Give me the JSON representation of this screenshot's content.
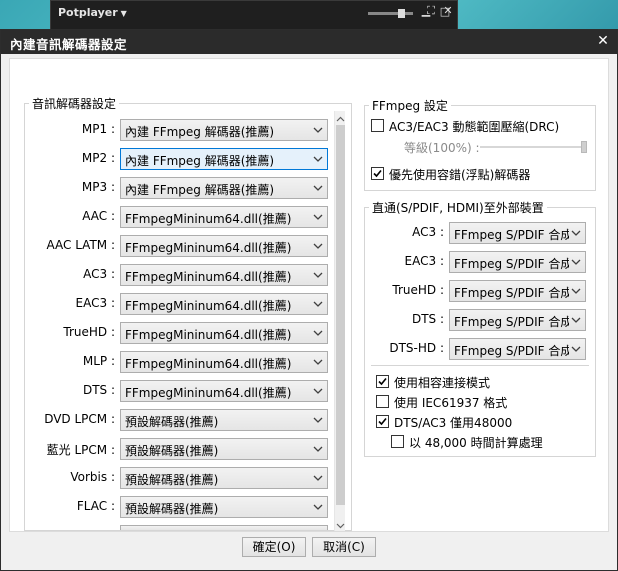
{
  "background_app": {
    "title": "Potplayer",
    "window_controls": [
      "▁",
      "□",
      "⛶",
      "✕"
    ]
  },
  "dialog": {
    "title": "內建音訊解碼器設定",
    "close_icon": "✕"
  },
  "decoder_group": {
    "legend": "音訊解碼器設定",
    "rows": [
      {
        "label": "MP1 :",
        "value": "內建 FFmpeg 解碼器(推薦)"
      },
      {
        "label": "MP2 :",
        "value": "內建 FFmpeg 解碼器(推薦)"
      },
      {
        "label": "MP3 :",
        "value": "內建 FFmpeg 解碼器(推薦)"
      },
      {
        "label": "AAC :",
        "value": "FFmpegMininum64.dll(推薦)"
      },
      {
        "label": "AAC LATM :",
        "value": "FFmpegMininum64.dll(推薦)"
      },
      {
        "label": "AC3 :",
        "value": "FFmpegMininum64.dll(推薦)"
      },
      {
        "label": "EAC3 :",
        "value": "FFmpegMininum64.dll(推薦)"
      },
      {
        "label": "TrueHD :",
        "value": "FFmpegMininum64.dll(推薦)"
      },
      {
        "label": "MLP :",
        "value": "FFmpegMininum64.dll(推薦)"
      },
      {
        "label": "DTS :",
        "value": "FFmpegMininum64.dll(推薦)"
      },
      {
        "label": "DVD LPCM :",
        "value": "預設解碼器(推薦)"
      },
      {
        "label": "藍光 LPCM :",
        "value": "預設解碼器(推薦)"
      },
      {
        "label": "Vorbis :",
        "value": "預設解碼器(推薦)"
      },
      {
        "label": "FLAC :",
        "value": "預設解碼器(推薦)"
      }
    ],
    "focused_index": 1
  },
  "ffmpeg_group": {
    "legend": "FFmpeg 設定",
    "drc_label": "AC3/EAC3 動態範圍壓縮(DRC)",
    "drc_checked": false,
    "level_label": "等級(100%) :",
    "level_value": 1.0,
    "float_decoder_label": "優先使用容錯(浮點)解碼器",
    "float_decoder_checked": true
  },
  "passthrough_group": {
    "legend": "直通(S/PDIF, HDMI)至外部裝置",
    "rows": [
      {
        "label": "AC3 :",
        "value": "FFmpeg S/PDIF 合成器"
      },
      {
        "label": "EAC3 :",
        "value": "FFmpeg S/PDIF 合成器"
      },
      {
        "label": "TrueHD :",
        "value": "FFmpeg S/PDIF 合成器"
      },
      {
        "label": "DTS :",
        "value": "FFmpeg S/PDIF 合成器"
      },
      {
        "label": "DTS-HD :",
        "value": "FFmpeg S/PDIF 合成器"
      }
    ],
    "checks": [
      {
        "label": "使用相容連接模式",
        "checked": true
      },
      {
        "label": "使用 IEC61937 格式",
        "checked": false
      },
      {
        "label": "DTS/AC3 僅用48000",
        "checked": true
      },
      {
        "label": "以 48,000 時間計算處理",
        "checked": false
      }
    ]
  },
  "footer": {
    "ok_label": "確定(O)",
    "cancel_label": "取消(C)"
  }
}
